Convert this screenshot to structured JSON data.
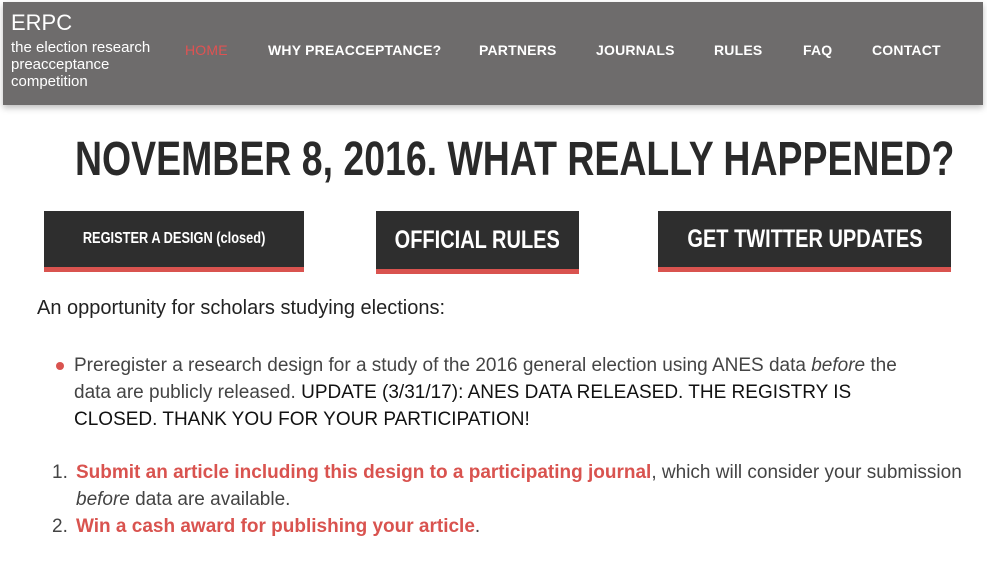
{
  "header": {
    "brand_name": "ERPC",
    "brand_tagline": "the election research preacceptance competition",
    "nav": [
      {
        "label": "HOME",
        "active": true
      },
      {
        "label": "WHY PREACCEPTANCE?",
        "active": false
      },
      {
        "label": "PARTNERS",
        "active": false
      },
      {
        "label": "JOURNALS",
        "active": false
      },
      {
        "label": "RULES",
        "active": false
      },
      {
        "label": "FAQ",
        "active": false
      },
      {
        "label": "CONTACT",
        "active": false
      }
    ]
  },
  "main": {
    "headline": "NOVEMBER 8, 2016.  WHAT REALLY HAPPENED?",
    "buttons": [
      {
        "label": "REGISTER A DESIGN (closed)"
      },
      {
        "label": "OFFICIAL RULES"
      },
      {
        "label": "GET TWITTER UPDATES"
      }
    ],
    "intro": "An opportunity for scholars studying elections:",
    "bullet": {
      "text_before": "Preregister a research design for a study of the 2016 general election using ANES data ",
      "emph": "before",
      "text_after": " the data are publicly released. ",
      "update": "UPDATE (3/31/17): ANES DATA RELEASED. THE REGISTRY IS CLOSED. THANK YOU FOR YOUR PARTICIPATION!"
    },
    "steps": [
      {
        "number": "1.",
        "link": "Submit an article including this design to a participating journal",
        "text_before": ", which will consider your submission ",
        "emph": "before",
        "text_after": " data are available."
      },
      {
        "number": "2.",
        "link": "Win a cash award for publishing your article",
        "text_after": "."
      }
    ]
  },
  "colors": {
    "header_bg": "#6e6c6c",
    "accent": "#d9534f",
    "button_bg": "#2e2e2e"
  }
}
